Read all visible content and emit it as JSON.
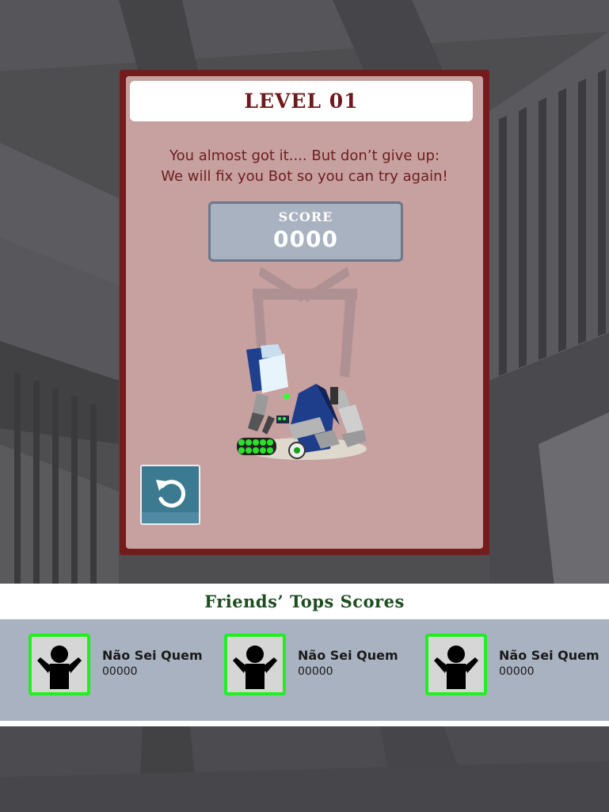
{
  "level": {
    "title": "LEVEL 01",
    "message_line1": "You almost got it.... But don’t give up:",
    "message_line2": "We will fix you Bot so you can try again!",
    "score_label": "SCORE",
    "score_value": "0000",
    "retry_icon": "retry-icon"
  },
  "friends": {
    "header": "Friends’ Tops Scores",
    "entries": [
      {
        "name": "Não Sei Quem",
        "score": "00000",
        "avatar_icon": "person-silhouette-icon"
      },
      {
        "name": "Não Sei Quem",
        "score": "00000",
        "avatar_icon": "person-silhouette-icon"
      },
      {
        "name": "Não Sei Quem",
        "score": "00000",
        "avatar_icon": "person-silhouette-icon"
      }
    ]
  },
  "colors": {
    "panel_frame": "#731b1d",
    "panel_fill": "#c7a0a0",
    "title_text": "#6e1a1c",
    "score_box": "#a9b2c0",
    "friends_header_text": "#1d4d20",
    "avatar_border": "#22ee22",
    "retry_button": "#3c7a91"
  }
}
